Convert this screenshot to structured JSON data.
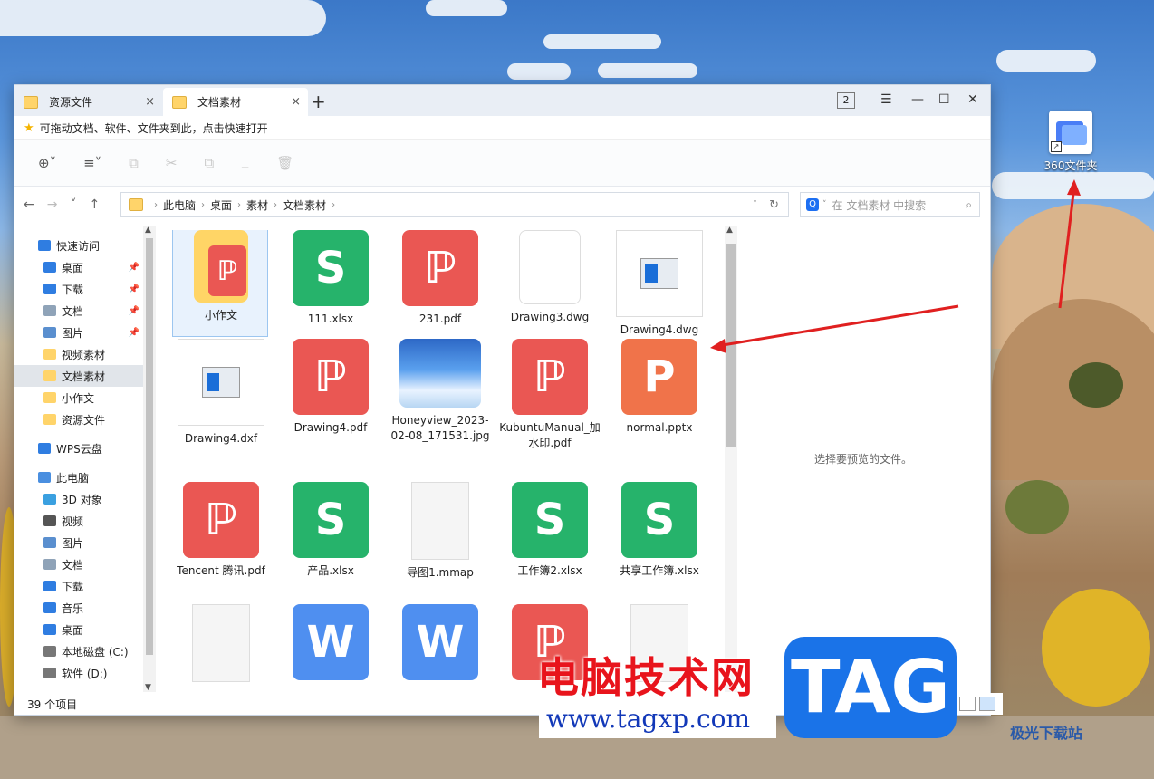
{
  "desktop": {
    "icon_label": "360文件夹"
  },
  "tabs": [
    {
      "label": "资源文件",
      "close": "×"
    },
    {
      "label": "文档素材",
      "close": "×"
    }
  ],
  "new_tab": "+",
  "window_controls": {
    "badge": "2",
    "menu": "☰",
    "minimize": "—",
    "maximize": "☐",
    "close": "✕"
  },
  "hint": "可拖动文档、软件、文件夹到此，点击快速打开",
  "toolbar": {
    "new": "⊕˅",
    "view": "≡˅",
    "copy": "⧉",
    "cut": "✂",
    "paste": "⧉",
    "rename": "⌶",
    "delete": "🗑"
  },
  "nav": {
    "back": "←",
    "forward": "→",
    "dropdown": "˅",
    "up": "↑"
  },
  "breadcrumb": [
    "此电脑",
    "桌面",
    "素材",
    "文档素材"
  ],
  "search_placeholder": "在 文档素材 中搜索",
  "sidebar": [
    {
      "label": "快速访问",
      "icon": "star-icon",
      "pin": ""
    },
    {
      "label": "桌面",
      "icon": "desktop-icon",
      "pin": "📌"
    },
    {
      "label": "下载",
      "icon": "download-icon",
      "pin": "📌"
    },
    {
      "label": "文档",
      "icon": "document-icon",
      "pin": "📌"
    },
    {
      "label": "图片",
      "icon": "picture-icon",
      "pin": "📌"
    },
    {
      "label": "视频素材",
      "icon": "folder-icon",
      "pin": ""
    },
    {
      "label": "文档素材",
      "icon": "folder-icon",
      "pin": ""
    },
    {
      "label": "小作文",
      "icon": "folder-icon",
      "pin": ""
    },
    {
      "label": "资源文件",
      "icon": "folder-icon",
      "pin": ""
    },
    {
      "label": "WPS云盘",
      "icon": "cloud-icon",
      "pin": ""
    },
    {
      "label": "此电脑",
      "icon": "computer-icon",
      "pin": ""
    },
    {
      "label": "3D 对象",
      "icon": "3d-icon",
      "pin": ""
    },
    {
      "label": "视频",
      "icon": "video-icon",
      "pin": ""
    },
    {
      "label": "图片",
      "icon": "picture-icon",
      "pin": ""
    },
    {
      "label": "文档",
      "icon": "document-icon",
      "pin": ""
    },
    {
      "label": "下载",
      "icon": "download-icon",
      "pin": ""
    },
    {
      "label": "音乐",
      "icon": "music-icon",
      "pin": ""
    },
    {
      "label": "桌面",
      "icon": "desktop-icon",
      "pin": ""
    },
    {
      "label": "本地磁盘 (C:)",
      "icon": "disk-icon",
      "pin": ""
    },
    {
      "label": "软件 (D:)",
      "icon": "disk-icon",
      "pin": ""
    }
  ],
  "files": [
    {
      "name": "小作文",
      "type": "folder",
      "glyph": "ℙ"
    },
    {
      "name": "111.xlsx",
      "type": "xls",
      "glyph": "S"
    },
    {
      "name": "231.pdf",
      "type": "pdf",
      "glyph": "ℙ"
    },
    {
      "name": "Drawing3.dwg",
      "type": "drw",
      "glyph": ""
    },
    {
      "name": "Drawing4.dwg",
      "type": "dwgwhite",
      "glyph": ""
    },
    {
      "name": "Drawing4.dxf",
      "type": "dwgwhite",
      "glyph": ""
    },
    {
      "name": "Drawing4.pdf",
      "type": "pdf",
      "glyph": "ℙ"
    },
    {
      "name": "Honeyview_2023-02-08_171531.jpg",
      "type": "img",
      "glyph": ""
    },
    {
      "name": "KubuntuManual_加水印.pdf",
      "type": "pdf",
      "glyph": "ℙ"
    },
    {
      "name": "normal.pptx",
      "type": "ppt",
      "glyph": "P"
    },
    {
      "name": "Tencent 腾讯.pdf",
      "type": "pdf",
      "glyph": "ℙ"
    },
    {
      "name": "产品.xlsx",
      "type": "xls",
      "glyph": "S"
    },
    {
      "name": "导图1.mmap",
      "type": "blank",
      "glyph": ""
    },
    {
      "name": "工作簿2.xlsx",
      "type": "xls",
      "glyph": "S"
    },
    {
      "name": "共享工作簿.xlsx",
      "type": "xls",
      "glyph": "S"
    },
    {
      "name": "",
      "type": "blank",
      "glyph": ""
    },
    {
      "name": "",
      "type": "doc",
      "glyph": "W"
    },
    {
      "name": "",
      "type": "doc",
      "glyph": "W"
    },
    {
      "name": "",
      "type": "pdf",
      "glyph": "ℙ"
    },
    {
      "name": "",
      "type": "blank",
      "glyph": ""
    }
  ],
  "preview_text": "选择要预览的文件。",
  "status": "39 个项目",
  "watermark": {
    "cn": "电脑技术网",
    "url": "www.tagxp.com",
    "tag": "TAG",
    "corner": "极光下载站"
  }
}
